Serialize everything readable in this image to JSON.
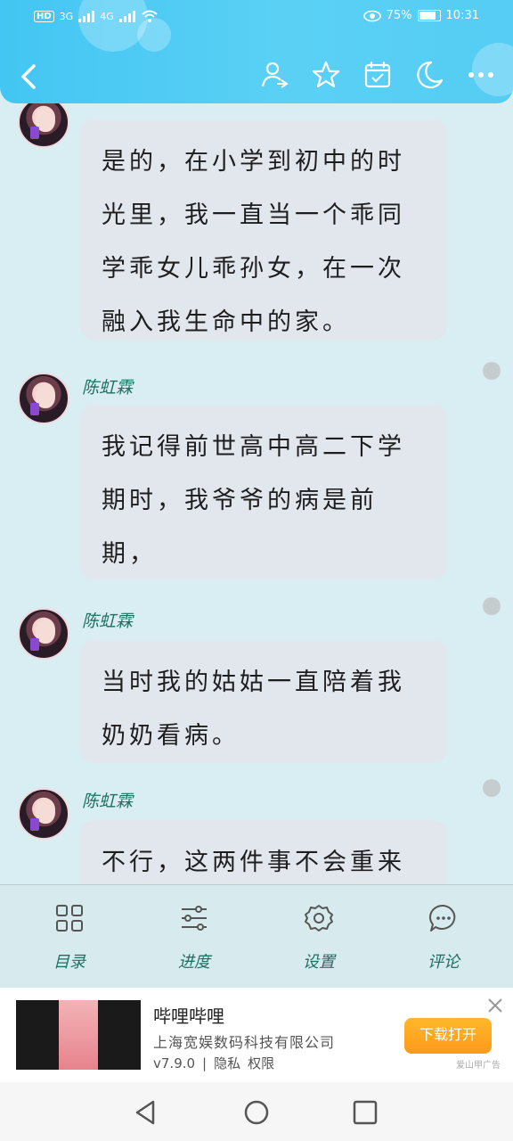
{
  "status_bar": {
    "left": {
      "hd": "HD",
      "net1": "3G",
      "net2": "4G"
    },
    "battery_percent": "75%",
    "time": "10:31"
  },
  "nav": {
    "icons": [
      "back-icon",
      "user-icon",
      "star-icon",
      "calendar-icon",
      "moon-icon",
      "more-icon"
    ]
  },
  "messages": [
    {
      "name": "",
      "text": "是的，在小学到初中的时光里，我一直当一个乖同学乖女儿乖孙女，在一次融入我生命中的家。"
    },
    {
      "name": "陈虹霖",
      "text": "我记得前世高中高二下学期时，我爷爷的病是前期，"
    },
    {
      "name": "陈虹霖",
      "text": "当时我的姑姑一直陪着我奶奶看病。"
    },
    {
      "name": "陈虹霖",
      "text": "不行，这两件事不会重来"
    }
  ],
  "toolbar": {
    "items": [
      {
        "label": "目录",
        "icon": "catalog-icon"
      },
      {
        "label": "进度",
        "icon": "progress-icon"
      },
      {
        "label": "设置",
        "icon": "settings-icon"
      },
      {
        "label": "评论",
        "icon": "comment-icon"
      }
    ]
  },
  "ad": {
    "title": "哔哩哔哩",
    "company": "上海宽娱数码科技有限公司",
    "version": "v7.9.0",
    "privacy": "隐私",
    "permission": "权限",
    "button": "下载打开",
    "source": "爱山甲广告"
  },
  "colors": {
    "topbar": "#43c6f3",
    "background": "#d9eef2",
    "accent_text": "#1f6f63",
    "bubble": "#e2e6ed",
    "ad_button": "#ff9a1a"
  }
}
